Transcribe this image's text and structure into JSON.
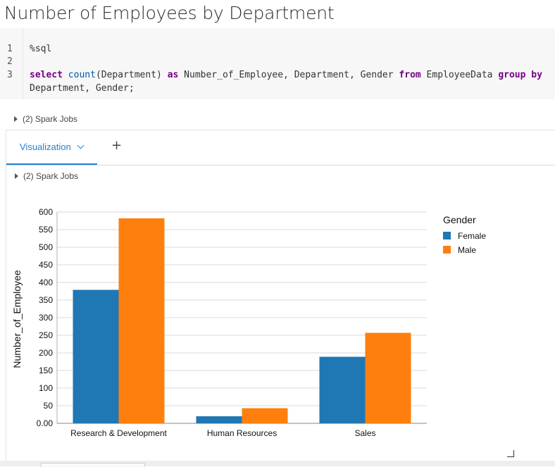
{
  "page": {
    "title": "Number of Employees by Department"
  },
  "code_cell": {
    "line_numbers": [
      "1",
      "2",
      "3"
    ],
    "line1": "%sql",
    "line3": {
      "kw_select": "select",
      "fn_count": "count",
      "t1": "(Department) ",
      "kw_as": "as",
      "t2": " Number_of_Employee, Department, Gender ",
      "kw_from": "from",
      "t3": " EmployeeData ",
      "kw_groupby": "group by",
      "wrap": "Department, Gender;"
    }
  },
  "spark_jobs_outer": "(2) Spark Jobs",
  "results": {
    "tab_label": "Visualization",
    "add_tab": "+",
    "spark_jobs_inner": "(2) Spark Jobs"
  },
  "chart_data": {
    "type": "bar",
    "categories": [
      "Research & Development",
      "Human Resources",
      "Sales"
    ],
    "series": [
      {
        "name": "Female",
        "values": [
          379,
          20,
          189
        ],
        "color": "#1f77b4"
      },
      {
        "name": "Male",
        "values": [
          582,
          43,
          257
        ],
        "color": "#ff7f0e"
      }
    ],
    "ylabel": "Number_of_Employee",
    "xlabel": "",
    "ylim": [
      0,
      600
    ],
    "yticks": [
      "0.00",
      "50",
      "100",
      "150",
      "200",
      "250",
      "300",
      "350",
      "400",
      "450",
      "500",
      "550",
      "600"
    ],
    "legend_title": "Gender",
    "legend_position": "top-right",
    "grid": true
  }
}
